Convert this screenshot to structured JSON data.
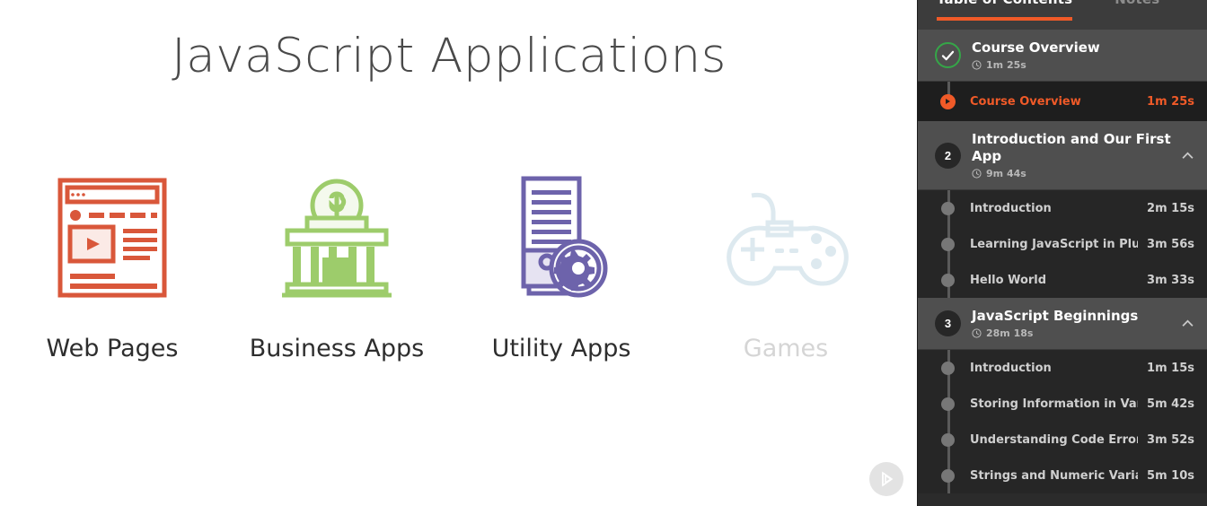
{
  "slide": {
    "title": "JavaScript Applications",
    "cards": [
      {
        "label": "Web Pages",
        "icon": "browser-window-icon",
        "color": "#d9573a",
        "faded": false
      },
      {
        "label": "Business Apps",
        "icon": "bank-building-icon",
        "color": "#9dcc6b",
        "faded": false
      },
      {
        "label": "Utility Apps",
        "icon": "server-gear-icon",
        "color": "#6d63ab",
        "faded": false
      },
      {
        "label": "Games",
        "icon": "gamepad-icon",
        "color": "#dbe9ef",
        "faded": true
      }
    ],
    "next_button": {
      "icon": "play-next-icon",
      "label": ""
    }
  },
  "sidebar": {
    "tabs": [
      {
        "label": "Table of Contents",
        "active": true
      },
      {
        "label": "Notes",
        "active": false
      }
    ],
    "accent_color": "#f05a28",
    "complete_color": "#35a648",
    "sections": [
      {
        "badge": "",
        "badge_state": "complete",
        "badge_icon": "check-circle-icon",
        "title": "Course Overview",
        "duration": "1m 25s",
        "clock_icon": "clock-icon",
        "chevron_icon": "",
        "lessons": [
          {
            "name": "Course Overview",
            "time": "1m 25s",
            "active": true,
            "icon": "play-circle-icon"
          }
        ]
      },
      {
        "badge": "2",
        "badge_state": "number",
        "badge_icon": "",
        "title": "Introduction and Our First App",
        "duration": "9m 44s",
        "clock_icon": "clock-icon",
        "chevron_icon": "chevron-up-icon",
        "lessons": [
          {
            "name": "Introduction",
            "time": "2m 15s",
            "active": false,
            "icon": ""
          },
          {
            "name": "Learning JavaScript in Plunker",
            "time": "3m 56s",
            "active": false,
            "icon": ""
          },
          {
            "name": "Hello World",
            "time": "3m 33s",
            "active": false,
            "icon": ""
          }
        ]
      },
      {
        "badge": "3",
        "badge_state": "number",
        "badge_icon": "",
        "title": "JavaScript Beginnings",
        "duration": "28m 18s",
        "clock_icon": "clock-icon",
        "chevron_icon": "chevron-up-icon",
        "lessons": [
          {
            "name": "Introduction",
            "time": "1m 15s",
            "active": false,
            "icon": ""
          },
          {
            "name": "Storing Information in Variables",
            "time": "5m 42s",
            "active": false,
            "icon": ""
          },
          {
            "name": "Understanding Code Errors",
            "time": "3m 52s",
            "active": false,
            "icon": ""
          },
          {
            "name": "Strings and Numeric Variables",
            "time": "5m 10s",
            "active": false,
            "icon": ""
          }
        ]
      }
    ]
  }
}
